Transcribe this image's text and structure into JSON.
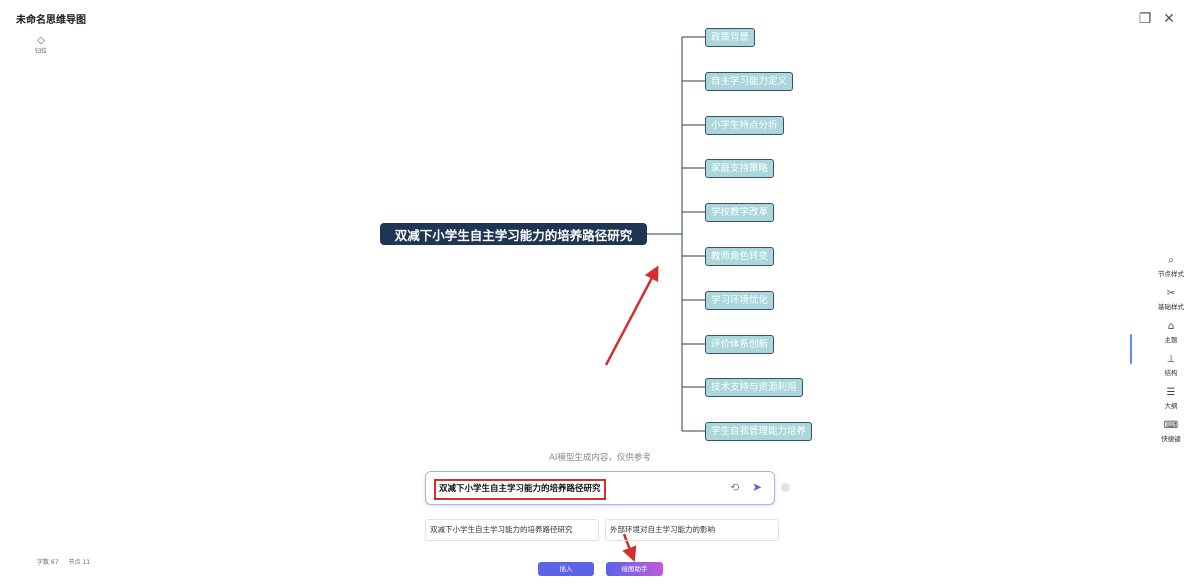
{
  "window": {
    "title": "未命名思维导图"
  },
  "toolbar": {
    "recenter_label": "归位",
    "recenter_icon": "diamond-icon"
  },
  "mindmap": {
    "root": "双减下小学生自主学习能力的培养路径研究",
    "children": [
      "政策背景",
      "自主学习能力定义",
      "小学生特点分析",
      "家庭支持策略",
      "学校教学改革",
      "教师角色转变",
      "学习环境优化",
      "评价体系创新",
      "技术支持与资源利用",
      "学生自我管理能力培养"
    ]
  },
  "ai": {
    "notice": "AI模型生成内容，仅供参考",
    "prompt_value": "双减下小学生自主学习能力的培养路径研究",
    "suggestions": [
      "双减下小学生自主学习能力的培养路径研究",
      "外部环境对自主学习能力的影响"
    ],
    "insert_label": "插入",
    "assistant_label": "绘图助手"
  },
  "stats": {
    "chars": "字数 67",
    "nodes": "节点 11"
  },
  "side_panel": [
    {
      "label": "节点样式",
      "icon": "brush-icon"
    },
    {
      "label": "基础样式",
      "icon": "tools-icon"
    },
    {
      "label": "主题",
      "icon": "shirt-icon"
    },
    {
      "label": "结构",
      "icon": "structure-icon"
    },
    {
      "label": "大纲",
      "icon": "outline-icon"
    },
    {
      "label": "快捷键",
      "icon": "keyboard-icon"
    }
  ],
  "colors": {
    "root_bg": "#1f3553",
    "child_bg": "#a9d7dc",
    "annotation_red": "#d32f2f",
    "accent": "#5b6bd8"
  }
}
